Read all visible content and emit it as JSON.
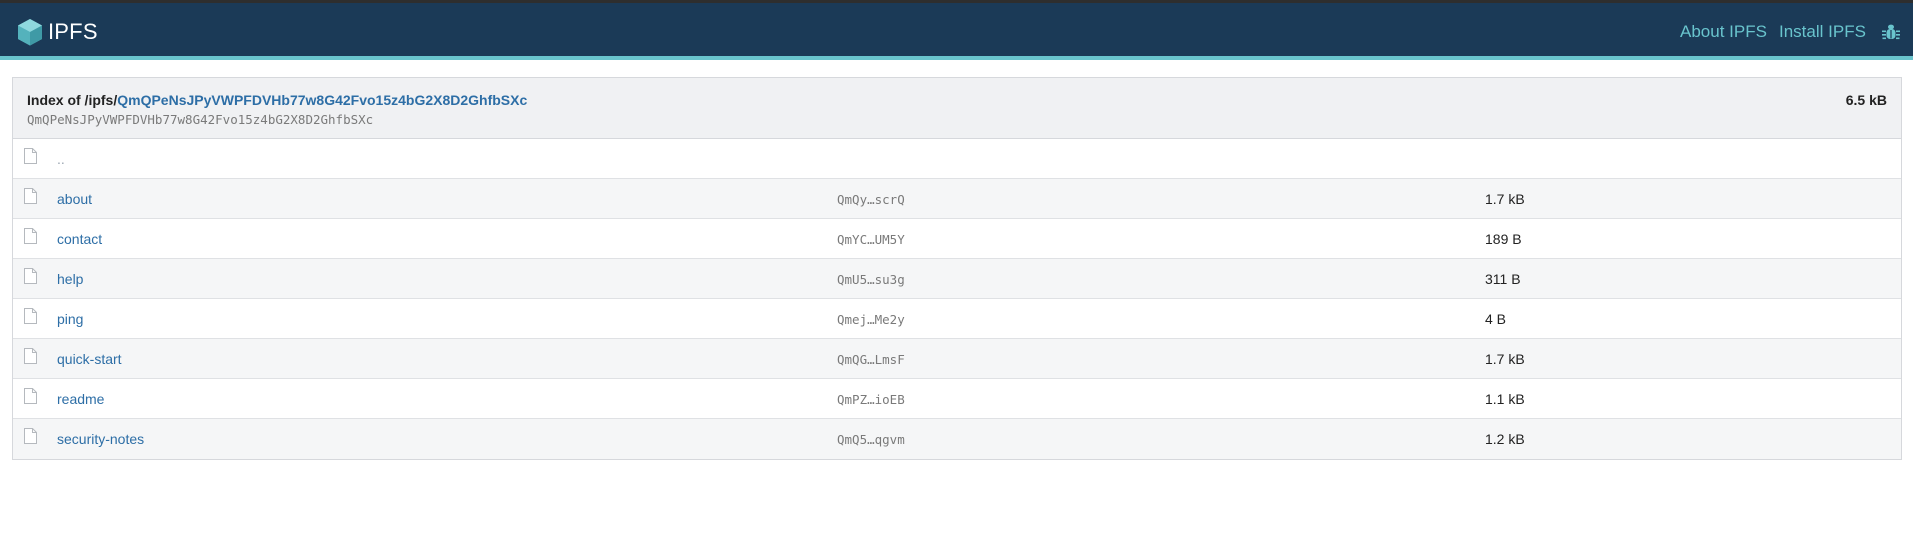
{
  "header": {
    "brand": "IPFS",
    "nav": {
      "about": "About IPFS",
      "install": "Install IPFS"
    }
  },
  "index": {
    "title_prefix": "Index of /ipfs/",
    "hash": "QmQPeNsJPyVWPFDVHb77w8G42Fvo15z4bG2X8D2GhfbSXc",
    "subtitle": "QmQPeNsJPyVWPFDVHb77w8G42Fvo15z4bG2X8D2GhfbSXc",
    "total_size": "6.5 kB"
  },
  "parent": {
    "name": ".."
  },
  "files": [
    {
      "name": "about",
      "hash": "QmQy…scrQ",
      "size": "1.7 kB"
    },
    {
      "name": "contact",
      "hash": "QmYC…UM5Y",
      "size": "189 B"
    },
    {
      "name": "help",
      "hash": "QmU5…su3g",
      "size": "311 B"
    },
    {
      "name": "ping",
      "hash": "Qmej…Me2y",
      "size": "4 B"
    },
    {
      "name": "quick-start",
      "hash": "QmQG…LmsF",
      "size": "1.7 kB"
    },
    {
      "name": "readme",
      "hash": "QmPZ…ioEB",
      "size": "1.1 kB"
    },
    {
      "name": "security-notes",
      "hash": "QmQ5…qgvm",
      "size": "1.2 kB"
    }
  ],
  "icons": {
    "logo": "ipfs-cube-logo",
    "bug": "bug-icon",
    "file": "file-icon"
  },
  "colors": {
    "header_bg": "#1b3a57",
    "accent": "#69c4cd",
    "link": "#2d6ea6"
  }
}
